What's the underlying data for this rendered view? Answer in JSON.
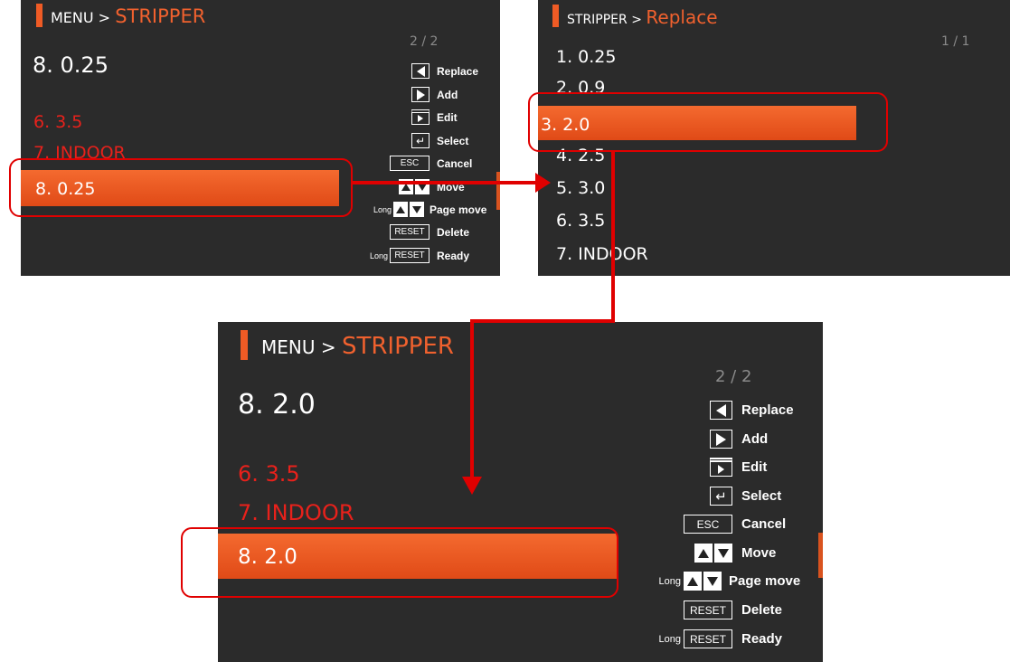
{
  "screen1": {
    "breadcrumb_prefix": "MENU >",
    "breadcrumb_current": "STRIPPER",
    "page_indicator": "2 / 2",
    "current_value": "8. 0.25",
    "items": [
      "6. 3.5",
      "7. INDOOR"
    ],
    "selected_item": "8. 0.25"
  },
  "screen2": {
    "breadcrumb_prefix": "STRIPPER >",
    "breadcrumb_current": "Replace",
    "page_indicator": "1 / 1",
    "items_before": [
      "1. 0.25",
      "2. 0.9"
    ],
    "selected_item": "3. 2.0",
    "items_after": [
      "4. 2.5",
      "5. 3.0",
      "6. 3.5",
      "7. INDOOR"
    ]
  },
  "screen3": {
    "breadcrumb_prefix": "MENU >",
    "breadcrumb_current": "STRIPPER",
    "page_indicator": "2 / 2",
    "current_value": "8. 2.0",
    "items": [
      "6. 3.5",
      "7. INDOOR"
    ],
    "selected_item": "8. 2.0"
  },
  "key_guide": {
    "replace": "Replace",
    "add": "Add",
    "edit": "Edit",
    "select": "Select",
    "esc_key": "ESC",
    "cancel": "Cancel",
    "move": "Move",
    "long": "Long",
    "page_move": "Page move",
    "reset_key": "RESET",
    "delete": "Delete",
    "ready": "Ready"
  },
  "colors": {
    "screen_bg": "#2b2b2b",
    "accent_orange": "#ef5b25",
    "red_text": "#e8211b",
    "annotation_red": "#e00000"
  }
}
